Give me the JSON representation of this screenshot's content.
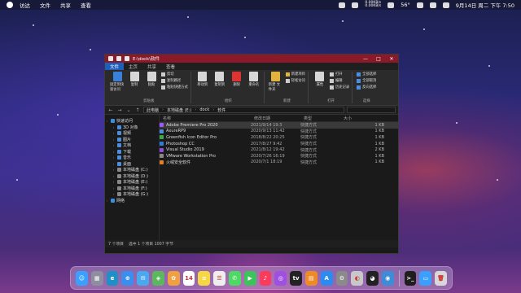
{
  "menubar": {
    "app": "访达",
    "items": [
      "文件",
      "共享",
      "查看"
    ],
    "net_up": "0.00KB/s",
    "net_down": "0.00KB/s",
    "temp": "56°",
    "datetime": "9月14日 周二 下午 7:50"
  },
  "window": {
    "title": "E:\\dock\\软件",
    "controls": [
      "—",
      "□",
      "✕"
    ],
    "ribbon_tabs": [
      "文件",
      "主页",
      "共享",
      "查看"
    ],
    "active_tab": "文件",
    "groups": {
      "clipboard": {
        "label": "剪贴板",
        "pin": "固定到快速访问",
        "copy": "复制",
        "paste": "粘贴",
        "cut": "剪切",
        "copy_path": "复制路径",
        "paste_shortcut": "粘贴快捷方式"
      },
      "organize": {
        "label": "组织",
        "move_to": "移动到",
        "copy_to": "复制到",
        "delete": "删除",
        "rename": "重命名"
      },
      "new": {
        "label": "新建",
        "new_folder": "新建\n文件夹",
        "new_item": "新建项目",
        "easy_access": "轻松访问"
      },
      "open": {
        "label": "打开",
        "properties": "属性",
        "open": "打开",
        "edit": "编辑",
        "history": "历史记录"
      },
      "select": {
        "label": "选择",
        "select_all": "全部选择",
        "select_none": "全部取消",
        "invert": "反向选择"
      }
    },
    "address": {
      "crumbs": [
        "此电脑",
        "本地磁盘 (E:)",
        "dock",
        "软件"
      ]
    },
    "nav": [
      {
        "label": "快速访问",
        "type": "star",
        "sub": false
      },
      {
        "label": "3D 对象",
        "type": "folder",
        "sub": true
      },
      {
        "label": "视频",
        "type": "folder",
        "sub": true
      },
      {
        "label": "图片",
        "type": "folder",
        "sub": true
      },
      {
        "label": "文档",
        "type": "folder",
        "sub": true
      },
      {
        "label": "下载",
        "type": "folder",
        "sub": true
      },
      {
        "label": "音乐",
        "type": "folder",
        "sub": true
      },
      {
        "label": "桌面",
        "type": "folder",
        "sub": true
      },
      {
        "label": "本地磁盘 (C:)",
        "type": "drive",
        "sub": true
      },
      {
        "label": "本地磁盘 (D:)",
        "type": "drive",
        "sub": true
      },
      {
        "label": "本地磁盘 (E:)",
        "type": "drive",
        "sub": true
      },
      {
        "label": "本地磁盘 (F:)",
        "type": "drive",
        "sub": true
      },
      {
        "label": "本地磁盘 (G:)",
        "type": "drive",
        "sub": true
      },
      {
        "label": "网络",
        "type": "net",
        "sub": false
      }
    ],
    "columns": [
      "名称",
      "修改日期",
      "类型",
      "大小"
    ],
    "files": [
      {
        "name": "Adobe Premiere Pro 2020",
        "date": "2021/9/14 19:3",
        "type": "快捷方式",
        "size": "1 KB",
        "color": "#9b59ff"
      },
      {
        "name": "AxureRP9",
        "date": "2020/9/13 11:42",
        "type": "快捷方式",
        "size": "1 KB",
        "color": "#4a8ee0"
      },
      {
        "name": "Greenfish Icon Editor Pro",
        "date": "2018/8/22 20:25",
        "type": "快捷方式",
        "size": "1 KB",
        "color": "#3ca84a"
      },
      {
        "name": "Photoshop CC",
        "date": "2017/8/27 9:42",
        "type": "快捷方式",
        "size": "1 KB",
        "color": "#2c7fd9"
      },
      {
        "name": "Visual Studio 2019",
        "date": "2021/8/12 19:42",
        "type": "快捷方式",
        "size": "2 KB",
        "color": "#8c4fe0"
      },
      {
        "name": "VMware Workstation Pro",
        "date": "2020/7/26 16:19",
        "type": "快捷方式",
        "size": "1 KB",
        "color": "#888888"
      },
      {
        "name": "火绒安全软件",
        "date": "2020/7/1 18:19",
        "type": "快捷方式",
        "size": "1 KB",
        "color": "#e67e22"
      }
    ],
    "status": {
      "count": "7 个项目",
      "selected": "选中 1 个项目 1007 字节"
    }
  },
  "dock_apps": [
    {
      "name": "finder",
      "color": "#3aa0ff",
      "glyph": "☺"
    },
    {
      "name": "launchpad",
      "color": "#8e8ea0",
      "glyph": "▦"
    },
    {
      "name": "edge",
      "color": "#1e90c8",
      "glyph": "e"
    },
    {
      "name": "safari",
      "color": "#3a8ef0",
      "glyph": "⊕"
    },
    {
      "name": "mail",
      "color": "#4aa8f0",
      "glyph": "✉"
    },
    {
      "name": "maps",
      "color": "#5cb85c",
      "glyph": "◈"
    },
    {
      "name": "photos",
      "color": "#f0a040",
      "glyph": "✿"
    },
    {
      "name": "calendar",
      "color": "#ffffff",
      "glyph": "14"
    },
    {
      "name": "notes",
      "color": "#f5d742",
      "glyph": "≡"
    },
    {
      "name": "reminders",
      "color": "#eeeeee",
      "glyph": "☰"
    },
    {
      "name": "messages",
      "color": "#4cd964",
      "glyph": "✆"
    },
    {
      "name": "facetime",
      "color": "#3cc35a",
      "glyph": "▶"
    },
    {
      "name": "music",
      "color": "#fa3c5a",
      "glyph": "♪"
    },
    {
      "name": "podcasts",
      "color": "#a050e0",
      "glyph": "◎"
    },
    {
      "name": "appletv",
      "color": "#222222",
      "glyph": "tv"
    },
    {
      "name": "books",
      "color": "#f08a24",
      "glyph": "▤"
    },
    {
      "name": "appstore",
      "color": "#2a8cf0",
      "glyph": "A"
    },
    {
      "name": "settings",
      "color": "#8a8a8a",
      "glyph": "⚙"
    },
    {
      "name": "preview",
      "color": "#c8c8c8",
      "glyph": "◐"
    },
    {
      "name": "qq",
      "color": "#222222",
      "glyph": "◕"
    },
    {
      "name": "wechat",
      "color": "#3c8cd8",
      "glyph": "◉"
    },
    {
      "name": "terminal",
      "color": "#1e1e1e",
      "glyph": ">_"
    },
    {
      "name": "finder-folder",
      "color": "#3aa0ff",
      "glyph": "▭"
    },
    {
      "name": "trash",
      "color": "#d8d8d8",
      "glyph": "🗑"
    }
  ]
}
